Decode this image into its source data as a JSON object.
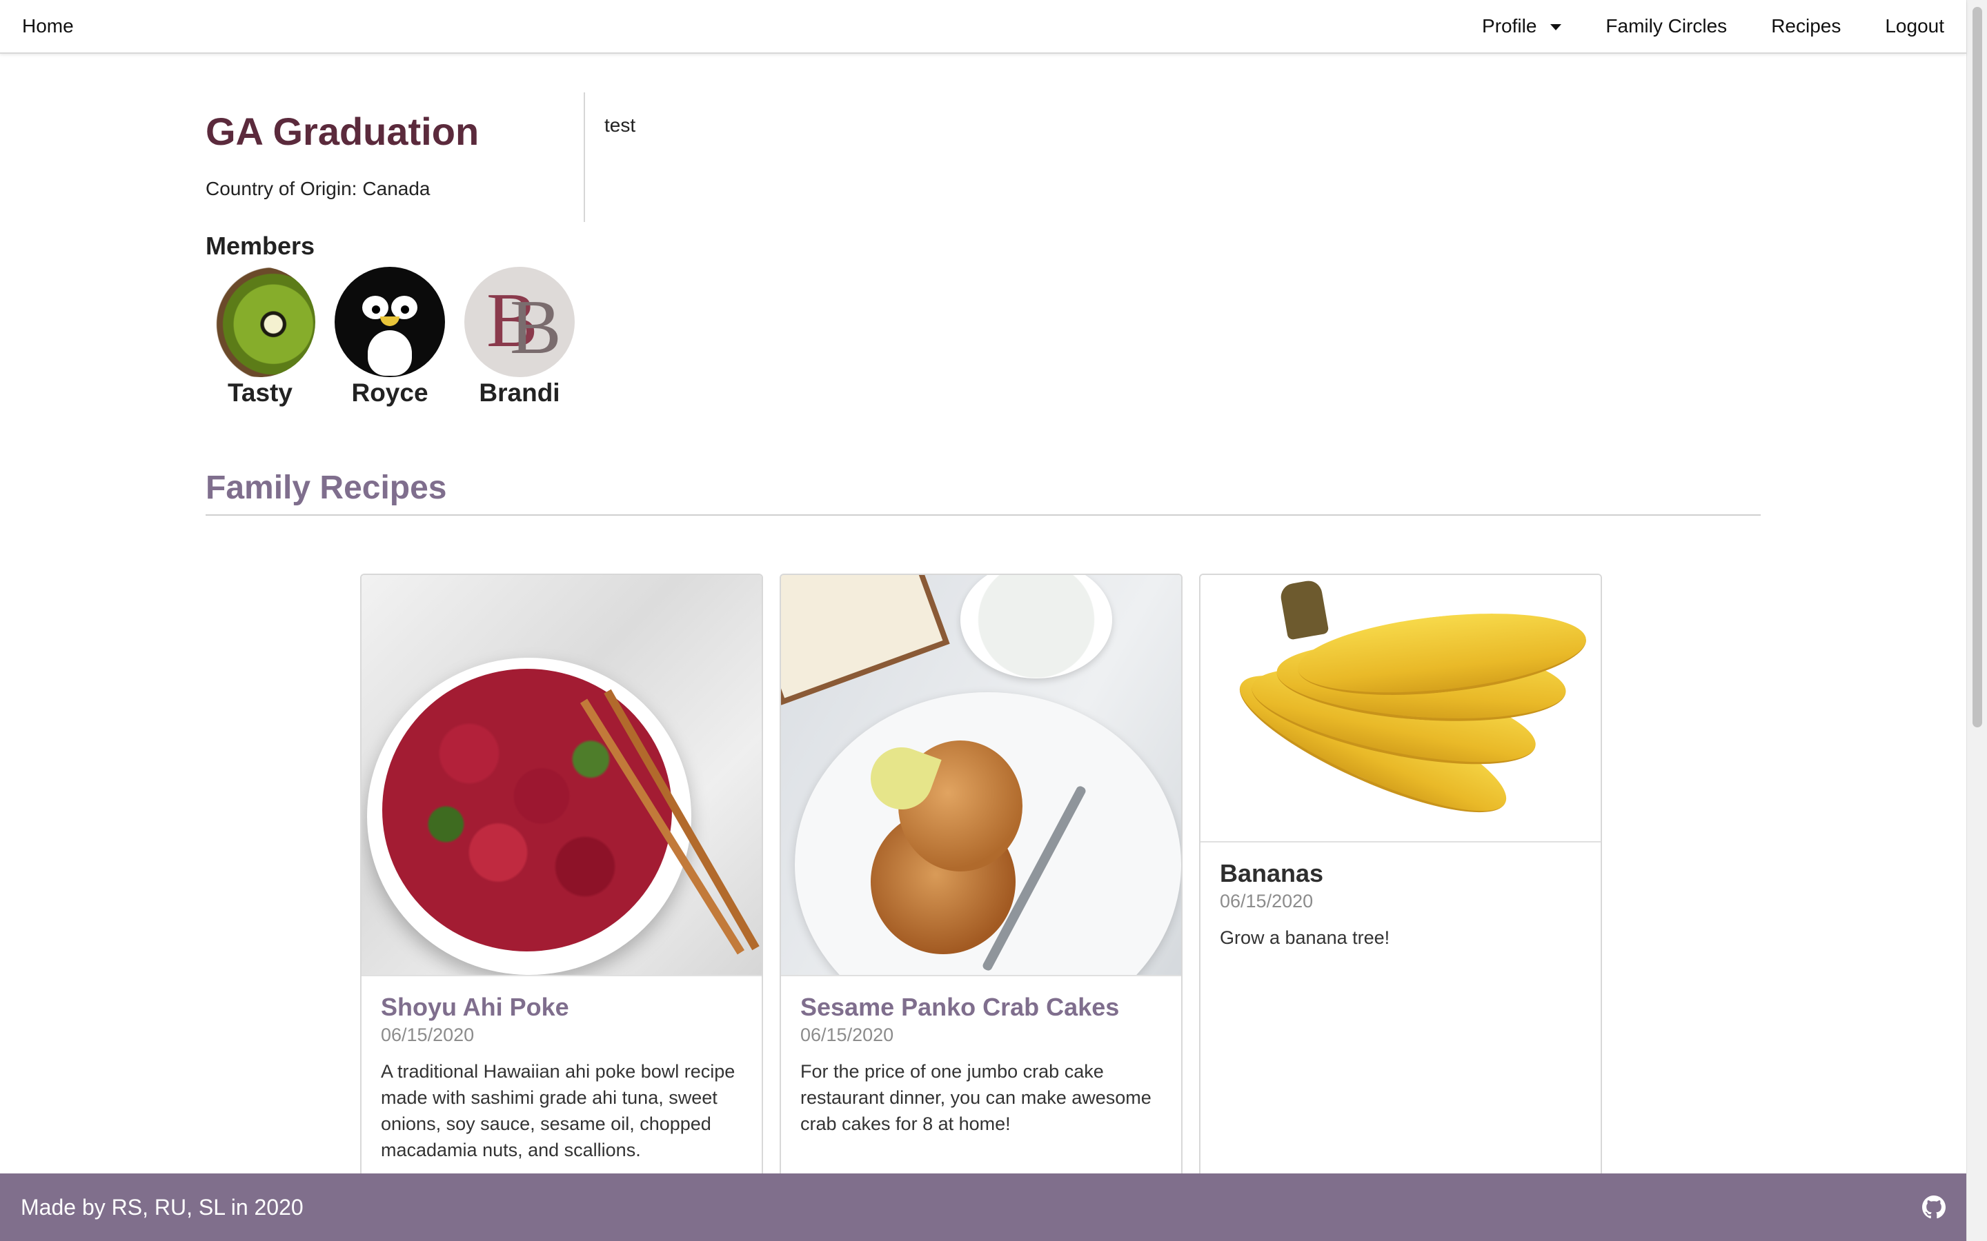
{
  "nav": {
    "home": "Home",
    "profile": "Profile",
    "family_circles": "Family Circles",
    "recipes": "Recipes",
    "logout": "Logout"
  },
  "circle": {
    "title": "GA Graduation",
    "origin_label": "Country of Origin:",
    "origin_value": "Canada",
    "description": "test"
  },
  "members": {
    "heading": "Members",
    "list": [
      {
        "name": "Tasty",
        "avatar": "kiwi-avatar"
      },
      {
        "name": "Royce",
        "avatar": "penguin-avatar"
      },
      {
        "name": "Brandi",
        "avatar": "bb-monogram-avatar"
      }
    ]
  },
  "recipes": {
    "heading": "Family Recipes",
    "cards": [
      {
        "title": "Shoyu Ahi Poke",
        "date": "06/15/2020",
        "description": "A traditional Hawaiian ahi poke bowl recipe made with sashimi grade ahi tuna, sweet onions, soy sauce, sesame oil, chopped macadamia nuts, and scallions.",
        "image": "poke-bowl-photo"
      },
      {
        "title": "Sesame Panko Crab Cakes",
        "date": "06/15/2020",
        "description": "For the price of one jumbo crab cake restaurant dinner, you can make awesome crab cakes for 8 at home!",
        "image": "crab-cakes-photo"
      },
      {
        "title": "Bananas",
        "date": "06/15/2020",
        "description": "Grow a banana tree!",
        "image": "bananas-photo"
      }
    ]
  },
  "footer": {
    "text": "Made by RS, RU, SL in 2020",
    "icon": "github-icon"
  },
  "colors": {
    "title": "#5b2a3c",
    "accent": "#7f6e8d",
    "footer_bg": "#806f8c"
  }
}
